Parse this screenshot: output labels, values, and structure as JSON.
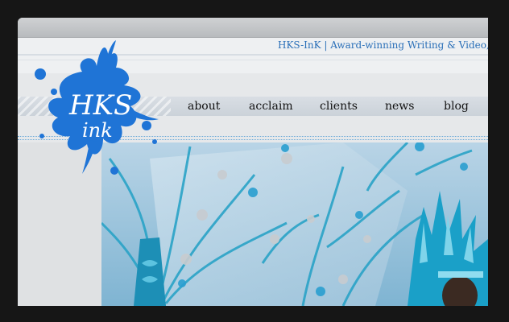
{
  "header": {
    "tagline": "HKS-InK | Award-winning Writing & Video, Strategi"
  },
  "logo": {
    "line1": "HKS",
    "line2": "ink",
    "color": "#1f74d6"
  },
  "nav": {
    "items": [
      {
        "label": "about"
      },
      {
        "label": "acclaim"
      },
      {
        "label": "clients"
      },
      {
        "label": "news"
      },
      {
        "label": "blog"
      }
    ]
  },
  "colors": {
    "background": "#161616",
    "accent": "#2a6fb8",
    "splash": "#1f74d6"
  }
}
